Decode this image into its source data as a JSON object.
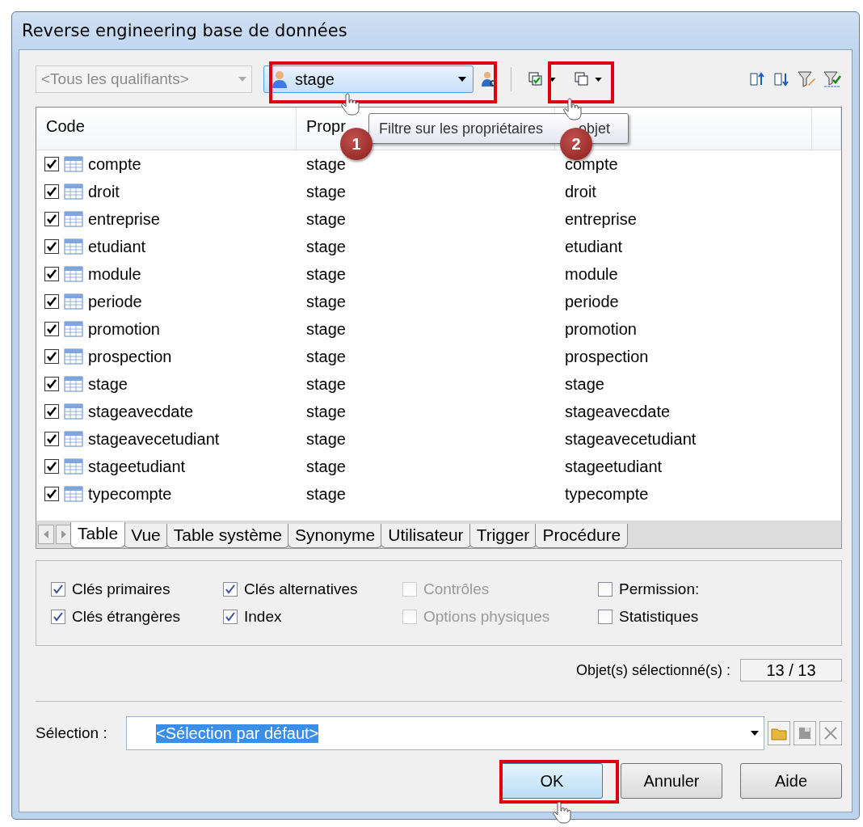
{
  "window": {
    "title": "Reverse engineering base de données"
  },
  "toolbar": {
    "qualifier": {
      "value": "<Tous les qualifiants>",
      "disabled": true
    },
    "owner": {
      "value": "stage"
    }
  },
  "tooltip": {
    "text": "Filtre sur les propriétaires",
    "text_end": "objet"
  },
  "annotations": [
    {
      "label": "1"
    },
    {
      "label": "2"
    }
  ],
  "table": {
    "columns": [
      "Code",
      "Propr"
    ],
    "rows": [
      {
        "code": "compte",
        "owner": "stage",
        "object": "compte",
        "checked": true
      },
      {
        "code": "droit",
        "owner": "stage",
        "object": "droit",
        "checked": true
      },
      {
        "code": "entreprise",
        "owner": "stage",
        "object": "entreprise",
        "checked": true
      },
      {
        "code": "etudiant",
        "owner": "stage",
        "object": "etudiant",
        "checked": true
      },
      {
        "code": "module",
        "owner": "stage",
        "object": "module",
        "checked": true
      },
      {
        "code": "periode",
        "owner": "stage",
        "object": "periode",
        "checked": true
      },
      {
        "code": "promotion",
        "owner": "stage",
        "object": "promotion",
        "checked": true
      },
      {
        "code": "prospection",
        "owner": "stage",
        "object": "prospection",
        "checked": true
      },
      {
        "code": "stage",
        "owner": "stage",
        "object": "stage",
        "checked": true
      },
      {
        "code": "stageavecdate",
        "owner": "stage",
        "object": "stageavecdate",
        "checked": true
      },
      {
        "code": "stageavecetudiant",
        "owner": "stage",
        "object": "stageavecetudiant",
        "checked": true
      },
      {
        "code": "stageetudiant",
        "owner": "stage",
        "object": "stageetudiant",
        "checked": true
      },
      {
        "code": "typecompte",
        "owner": "stage",
        "object": "typecompte",
        "checked": true
      }
    ]
  },
  "tabs": [
    {
      "label": "Table",
      "selected": true
    },
    {
      "label": "Vue",
      "selected": false
    },
    {
      "label": "Table système",
      "selected": false
    },
    {
      "label": "Synonyme",
      "selected": false
    },
    {
      "label": "Utilisateur",
      "selected": false
    },
    {
      "label": "Trigger",
      "selected": false
    },
    {
      "label": "Procédure",
      "selected": false
    }
  ],
  "options": [
    {
      "label": "Clés primaires",
      "checked": true,
      "disabled": false
    },
    {
      "label": "Clés alternatives",
      "checked": true,
      "disabled": false
    },
    {
      "label": "Contrôles",
      "checked": false,
      "disabled": true
    },
    {
      "label": "Permission:",
      "checked": false,
      "disabled": false
    },
    {
      "label": "Clés étrangères",
      "checked": true,
      "disabled": false
    },
    {
      "label": "Index",
      "checked": true,
      "disabled": false
    },
    {
      "label": "Options physiques",
      "checked": false,
      "disabled": true
    },
    {
      "label": "Statistiques",
      "checked": false,
      "disabled": false
    }
  ],
  "count": {
    "label": "Objet(s) sélectionné(s) :",
    "value": "13 / 13"
  },
  "selection": {
    "label": "Sélection :",
    "value": "<Sélection par défaut>"
  },
  "buttons": [
    {
      "label": "OK",
      "highlighted": true
    },
    {
      "label": "Annuler",
      "highlighted": false
    },
    {
      "label": "Aide",
      "highlighted": false
    }
  ]
}
